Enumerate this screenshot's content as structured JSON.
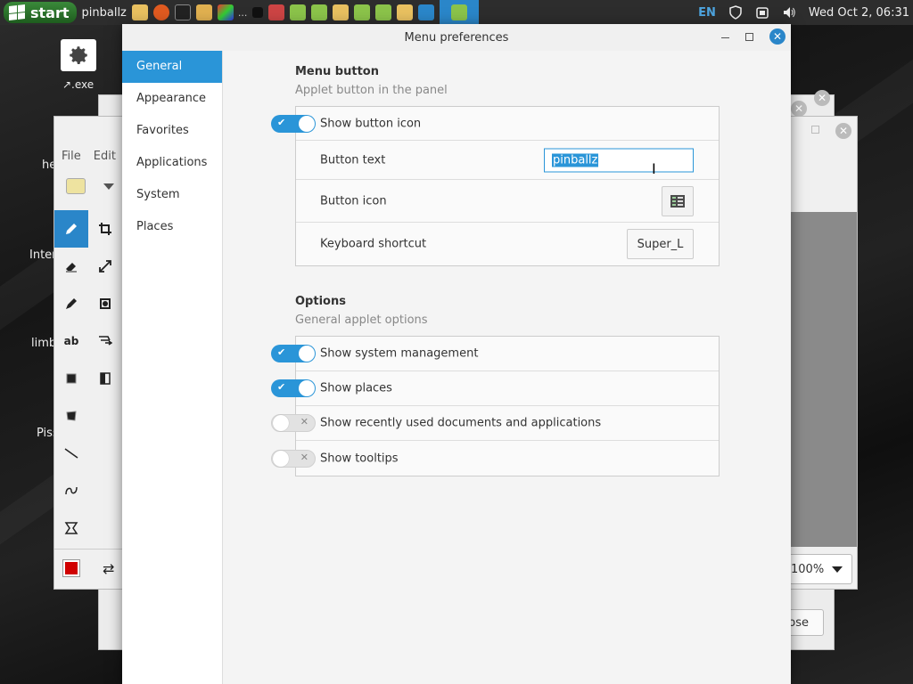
{
  "panel": {
    "start_label": "start",
    "label": "pinballz",
    "lang": "EN",
    "clock": "Wed Oct  2, 06:31",
    "dots": "..."
  },
  "desktop": {
    "exe_label": "↗.exe",
    "side_labels": [
      "he",
      "Inter",
      "limb",
      "Piss"
    ]
  },
  "bg_window": {
    "menu": [
      "File",
      "Edit"
    ],
    "zoom": "100%",
    "close_label": "ose"
  },
  "dialog": {
    "title": "Menu preferences",
    "sidebar": [
      "General",
      "Appearance",
      "Favorites",
      "Applications",
      "System",
      "Places"
    ],
    "selected_index": 0,
    "menu_button": {
      "title": "Menu button",
      "subtitle": "Applet button in the panel",
      "show_button_icon_label": "Show button icon",
      "show_button_icon": true,
      "button_text_label": "Button text",
      "button_text_value": "pinballz",
      "button_icon_label": "Button icon",
      "keyboard_shortcut_label": "Keyboard shortcut",
      "keyboard_shortcut_value": "Super_L"
    },
    "options": {
      "title": "Options",
      "subtitle": "General applet options",
      "rows": [
        {
          "label": "Show system management",
          "on": true
        },
        {
          "label": "Show places",
          "on": true
        },
        {
          "label": "Show recently used documents and applications",
          "on": false
        },
        {
          "label": "Show tooltips",
          "on": false
        }
      ]
    }
  },
  "colors": {
    "accent": "#2a95d8",
    "panel_bg": "#2d2d2d",
    "start_green": "#2e7d2e"
  }
}
